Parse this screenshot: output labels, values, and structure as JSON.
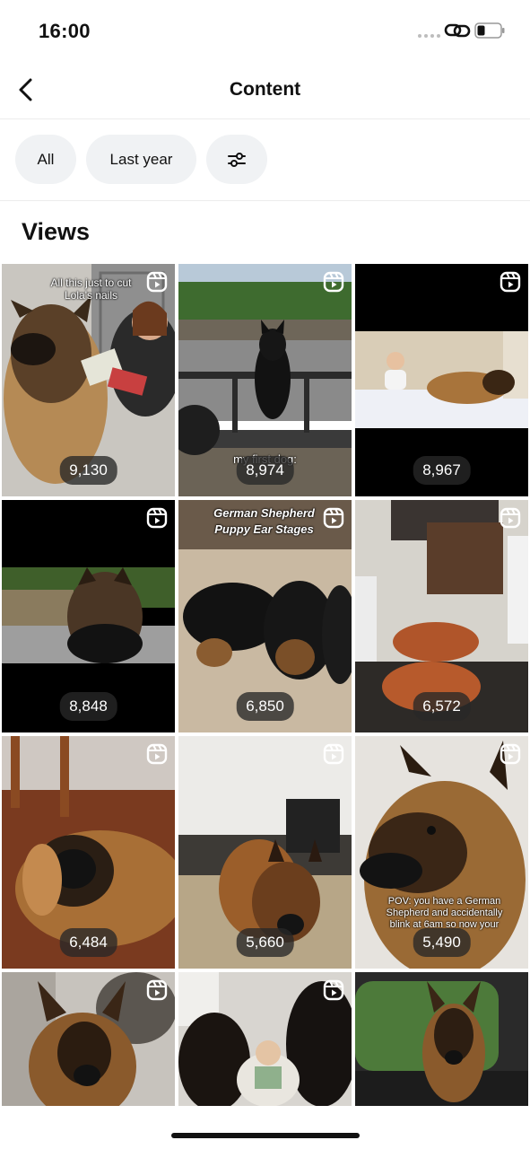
{
  "status_bar": {
    "time": "16:00"
  },
  "header": {
    "title": "Content"
  },
  "filters": {
    "all_label": "All",
    "period_label": "Last year"
  },
  "section": {
    "title": "Views"
  },
  "reels": [
    {
      "views": "9,130",
      "caption": "All this just to cut Lola's nails"
    },
    {
      "views": "8,974",
      "caption": "my first dog:"
    },
    {
      "views": "8,967",
      "caption": ""
    },
    {
      "views": "8,848",
      "caption": ""
    },
    {
      "views": "6,850",
      "caption": "German Shepherd Puppy Ear Stages"
    },
    {
      "views": "6,572",
      "caption": ""
    },
    {
      "views": "6,484",
      "caption": ""
    },
    {
      "views": "5,660",
      "caption": ""
    },
    {
      "views": "5,490",
      "caption": "POV: you have a German Shepherd and accidentally blink at 6am so now your"
    },
    {
      "views": "",
      "caption": ""
    },
    {
      "views": "",
      "caption": ""
    },
    {
      "views": "",
      "caption": ""
    }
  ],
  "icons": {
    "back": "chevron-left-icon",
    "filter": "sliders-icon",
    "reel": "reel-icon",
    "link": "link-icon",
    "battery": "battery-icon"
  }
}
